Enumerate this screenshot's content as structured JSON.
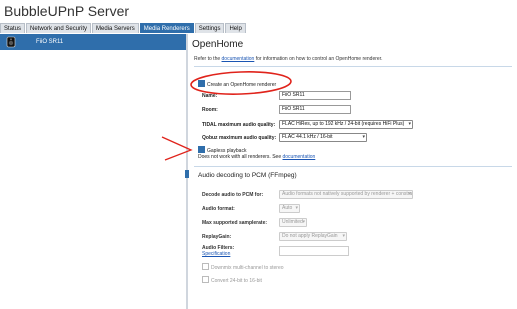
{
  "app": {
    "title": "BubbleUPnP   Server"
  },
  "nav": {
    "tabs": [
      {
        "label": "Status"
      },
      {
        "label": "Network and Security"
      },
      {
        "label": "Media Servers"
      },
      {
        "label": "Media Renderers"
      },
      {
        "label": "Settings"
      },
      {
        "label": "Help"
      }
    ],
    "active_index": 3
  },
  "sidebar": {
    "device_label": "FiiO SR11",
    "device_icon": "speaker-icon"
  },
  "main": {
    "heading": "OpenHome",
    "info_prefix": "Refer to the ",
    "info_link": "documentation",
    "info_suffix": " for information on how to control an OpenHome renderer.",
    "create_label": "Create an OpenHome renderer",
    "create_checked": true,
    "name_label": "Name:",
    "name_value": "FiiO SR11",
    "room_label": "Room:",
    "room_value": "FiiO SR11",
    "tidal_label": "TIDAL maximum audio quality:",
    "tidal_value": "FLAC HiRes, up to 192 kHz / 24-bit (requires HiFi Plus)",
    "qobuz_label": "Qobuz maximum audio quality:",
    "qobuz_value": "FLAC 44.1 kHz / 16-bit",
    "gapless_label": "Gapless playback",
    "gapless_checked": true,
    "gapless_note": "Does not work with all renderers. See ",
    "gapless_link": "documentation",
    "audio_section": "Audio decoding to PCM (FFmpeg)",
    "decode_label": "Decode audio to PCM for:",
    "decode_value": "Audio formats not natively supported by renderer + constraints below",
    "format_label": "Audio format:",
    "format_value": "Auto",
    "samplerate_label": "Max supported samplerate:",
    "samplerate_value": "Unlimited",
    "replaygain_label": "ReplayGain:",
    "replaygain_value": "Do not apply ReplayGain",
    "filters_label": "Audio Filters:",
    "filters_link": "Specification",
    "downmix_label": "Downmix multi-channel to stereo",
    "convert_label": "Convert 24-bit to 16-bit"
  },
  "annotation": {
    "color": "#e0231b"
  }
}
